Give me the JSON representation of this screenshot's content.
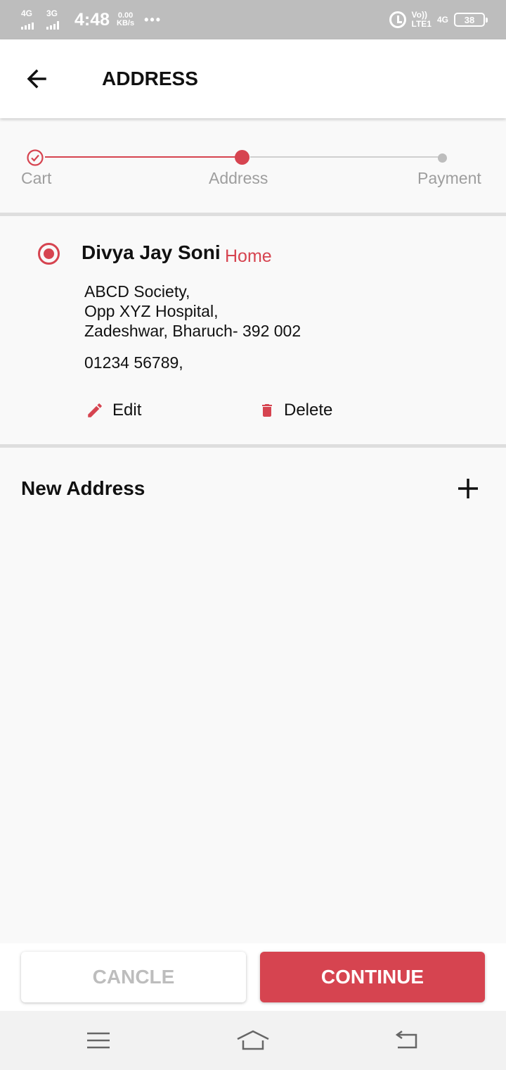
{
  "status_bar": {
    "signal1": "4G",
    "signal2": "3G",
    "time": "4:48",
    "speed_value": "0.00",
    "speed_unit": "KB/s",
    "more": "•••",
    "volte_top": "Vo))",
    "volte_bottom": "LTE1",
    "network": "4G",
    "battery": "38"
  },
  "app_bar": {
    "title": "ADDRESS"
  },
  "stepper": {
    "steps": [
      {
        "label": "Cart"
      },
      {
        "label": "Address"
      },
      {
        "label": "Payment"
      }
    ],
    "active_color": "#d64450",
    "inactive_color": "#bdbdbd"
  },
  "address": {
    "name": "Divya Jay Soni",
    "tag": "Home",
    "lines": [
      "ABCD Society,",
      "Opp XYZ Hospital,",
      "Zadeshwar, Bharuch- 392 002"
    ],
    "phone": "01234 56789,",
    "edit_label": "Edit",
    "delete_label": "Delete"
  },
  "new_address": {
    "label": "New Address"
  },
  "buttons": {
    "cancel": "CANCLE",
    "continue": "CONTINUE"
  },
  "colors": {
    "accent": "#d64450",
    "statusbar": "#bdbdbd"
  }
}
